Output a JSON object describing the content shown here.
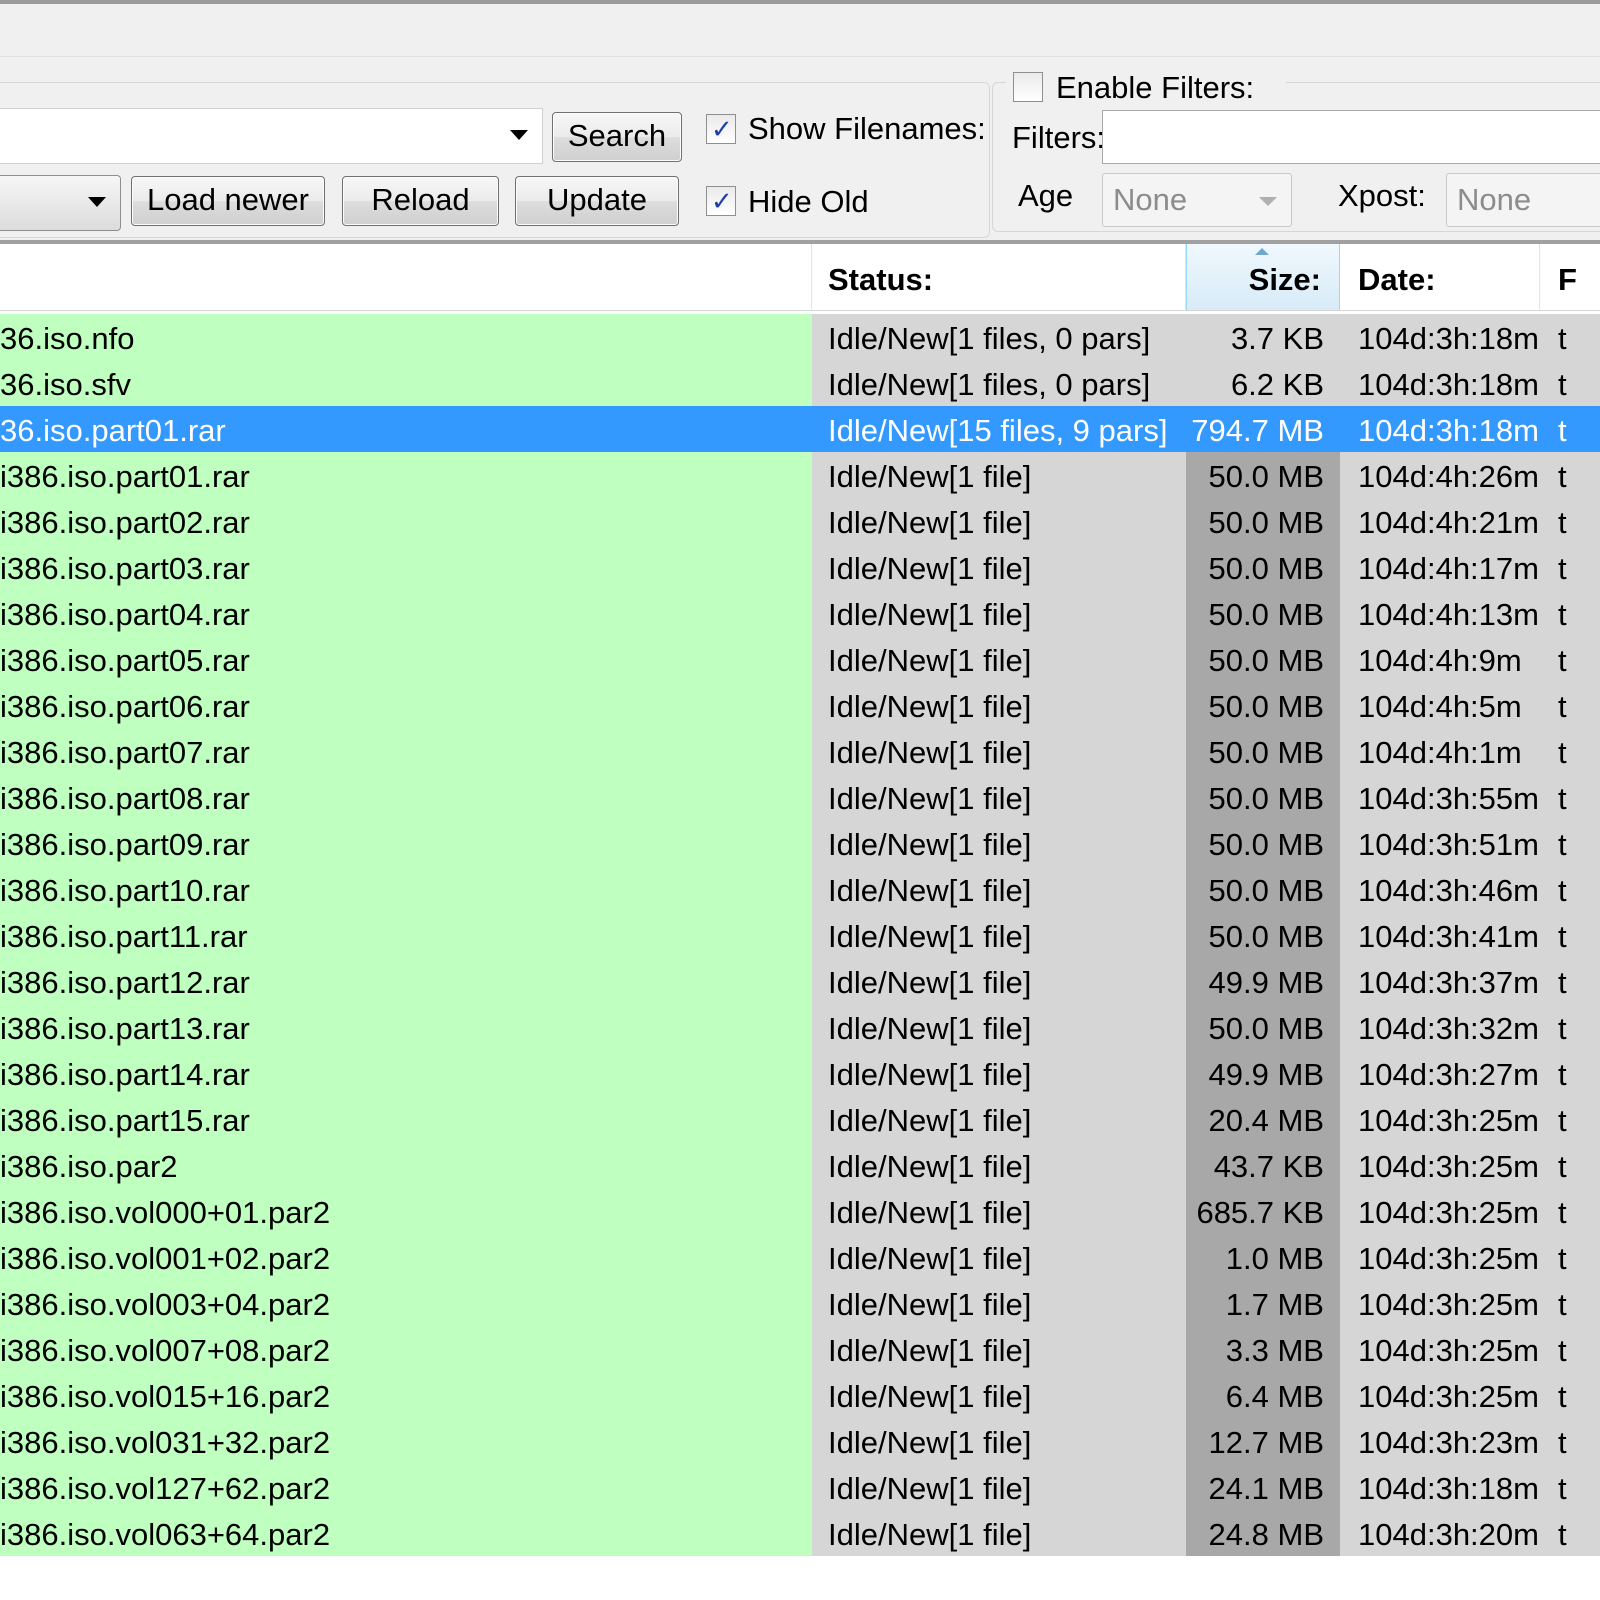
{
  "toolbar": {
    "search_label": "Search",
    "load_newer_label": "Load newer",
    "reload_label": "Reload",
    "update_label": "Update",
    "show_filenames_label": "Show Filenames:",
    "show_filenames_checked": true,
    "hide_old_label": "Hide Old",
    "hide_old_checked": true
  },
  "filters": {
    "enable_filters_label": "Enable Filters:",
    "enable_filters_checked": false,
    "filters_label": "Filters:",
    "age_label": "Age",
    "age_value": "None",
    "xpost_label": "Xpost:",
    "xpost_value": "None"
  },
  "list": {
    "columns": {
      "status": "Status:",
      "size": "Size:",
      "date": "Date:",
      "extra": "F"
    },
    "rows": [
      {
        "name": "36.iso.nfo",
        "status": "Idle/New[1 files, 0 pars]",
        "size": "3.7 KB",
        "date": "104d:3h:18m",
        "extra": "t"
      },
      {
        "name": "36.iso.sfv",
        "status": "Idle/New[1 files, 0 pars]",
        "size": "6.2 KB",
        "date": "104d:3h:18m",
        "extra": "t"
      },
      {
        "name": "36.iso.part01.rar",
        "status": "Idle/New[15 files, 9 pars]",
        "size": "794.7 MB",
        "date": "104d:3h:18m",
        "extra": "t"
      },
      {
        "name": "i386.iso.part01.rar",
        "status": "Idle/New[1 file]",
        "size": "50.0 MB",
        "date": "104d:4h:26m",
        "extra": "t"
      },
      {
        "name": "i386.iso.part02.rar",
        "status": "Idle/New[1 file]",
        "size": "50.0 MB",
        "date": "104d:4h:21m",
        "extra": "t"
      },
      {
        "name": "i386.iso.part03.rar",
        "status": "Idle/New[1 file]",
        "size": "50.0 MB",
        "date": "104d:4h:17m",
        "extra": "t"
      },
      {
        "name": "i386.iso.part04.rar",
        "status": "Idle/New[1 file]",
        "size": "50.0 MB",
        "date": "104d:4h:13m",
        "extra": "t"
      },
      {
        "name": "i386.iso.part05.rar",
        "status": "Idle/New[1 file]",
        "size": "50.0 MB",
        "date": "104d:4h:9m",
        "extra": "t"
      },
      {
        "name": "i386.iso.part06.rar",
        "status": "Idle/New[1 file]",
        "size": "50.0 MB",
        "date": "104d:4h:5m",
        "extra": "t"
      },
      {
        "name": "i386.iso.part07.rar",
        "status": "Idle/New[1 file]",
        "size": "50.0 MB",
        "date": "104d:4h:1m",
        "extra": "t"
      },
      {
        "name": "i386.iso.part08.rar",
        "status": "Idle/New[1 file]",
        "size": "50.0 MB",
        "date": "104d:3h:55m",
        "extra": "t"
      },
      {
        "name": "i386.iso.part09.rar",
        "status": "Idle/New[1 file]",
        "size": "50.0 MB",
        "date": "104d:3h:51m",
        "extra": "t"
      },
      {
        "name": "i386.iso.part10.rar",
        "status": "Idle/New[1 file]",
        "size": "50.0 MB",
        "date": "104d:3h:46m",
        "extra": "t"
      },
      {
        "name": "i386.iso.part11.rar",
        "status": "Idle/New[1 file]",
        "size": "50.0 MB",
        "date": "104d:3h:41m",
        "extra": "t"
      },
      {
        "name": "i386.iso.part12.rar",
        "status": "Idle/New[1 file]",
        "size": "49.9 MB",
        "date": "104d:3h:37m",
        "extra": "t"
      },
      {
        "name": "i386.iso.part13.rar",
        "status": "Idle/New[1 file]",
        "size": "50.0 MB",
        "date": "104d:3h:32m",
        "extra": "t"
      },
      {
        "name": "i386.iso.part14.rar",
        "status": "Idle/New[1 file]",
        "size": "49.9 MB",
        "date": "104d:3h:27m",
        "extra": "t"
      },
      {
        "name": "i386.iso.part15.rar",
        "status": "Idle/New[1 file]",
        "size": "20.4 MB",
        "date": "104d:3h:25m",
        "extra": "t"
      },
      {
        "name": "i386.iso.par2",
        "status": "Idle/New[1 file]",
        "size": "43.7 KB",
        "date": "104d:3h:25m",
        "extra": "t"
      },
      {
        "name": "i386.iso.vol000+01.par2",
        "status": "Idle/New[1 file]",
        "size": "685.7 KB",
        "date": "104d:3h:25m",
        "extra": "t"
      },
      {
        "name": "i386.iso.vol001+02.par2",
        "status": "Idle/New[1 file]",
        "size": "1.0 MB",
        "date": "104d:3h:25m",
        "extra": "t"
      },
      {
        "name": "i386.iso.vol003+04.par2",
        "status": "Idle/New[1 file]",
        "size": "1.7 MB",
        "date": "104d:3h:25m",
        "extra": "t"
      },
      {
        "name": "i386.iso.vol007+08.par2",
        "status": "Idle/New[1 file]",
        "size": "3.3 MB",
        "date": "104d:3h:25m",
        "extra": "t"
      },
      {
        "name": "i386.iso.vol015+16.par2",
        "status": "Idle/New[1 file]",
        "size": "6.4 MB",
        "date": "104d:3h:25m",
        "extra": "t"
      },
      {
        "name": "i386.iso.vol031+32.par2",
        "status": "Idle/New[1 file]",
        "size": "12.7 MB",
        "date": "104d:3h:23m",
        "extra": "t"
      },
      {
        "name": "i386.iso.vol127+62.par2",
        "status": "Idle/New[1 file]",
        "size": "24.1 MB",
        "date": "104d:3h:18m",
        "extra": "t"
      },
      {
        "name": "i386.iso.vol063+64.par2",
        "status": "Idle/New[1 file]",
        "size": "24.8 MB",
        "date": "104d:3h:20m",
        "extra": "t"
      }
    ]
  }
}
